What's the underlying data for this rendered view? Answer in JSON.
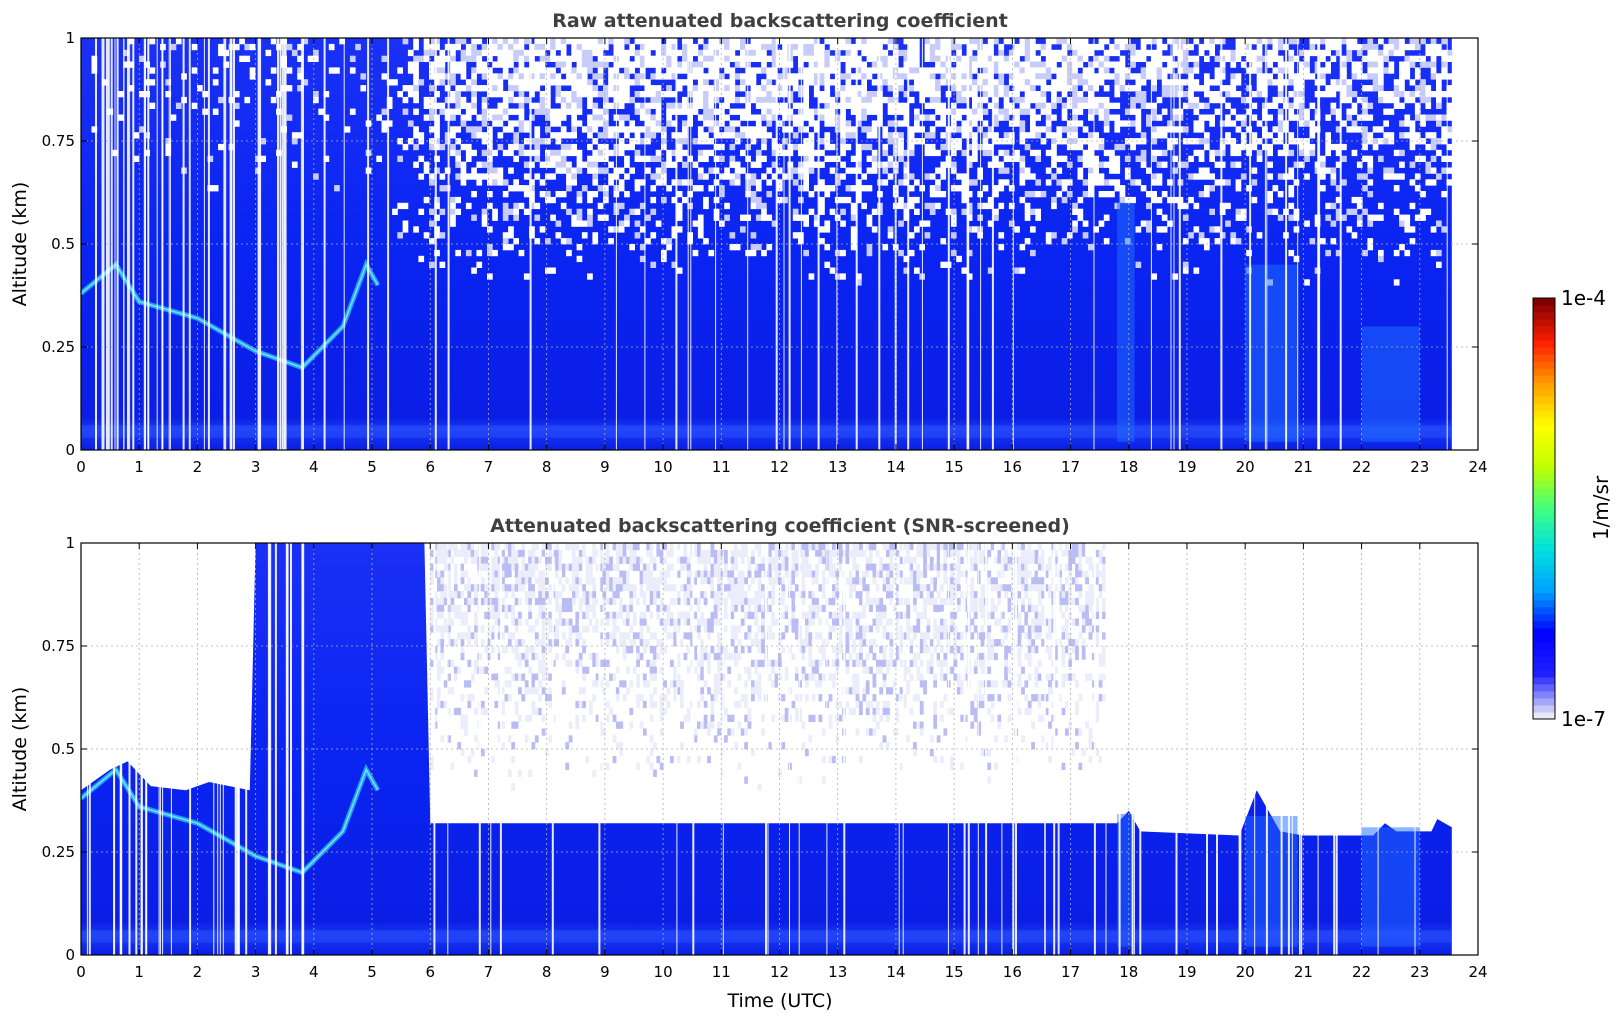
{
  "chart_data": [
    {
      "type": "heatmap",
      "title": "Raw attenuated backscattering coefficient",
      "xlabel": "",
      "ylabel": "Altitude (km)",
      "xlim": [
        0,
        24
      ],
      "ylim": [
        0,
        1
      ],
      "x_ticks": [
        "0",
        "1",
        "2",
        "3",
        "4",
        "5",
        "6",
        "7",
        "8",
        "9",
        "10",
        "11",
        "12",
        "13",
        "14",
        "15",
        "16",
        "17",
        "18",
        "19",
        "20",
        "21",
        "22",
        "23",
        "24"
      ],
      "y_ticks": [
        "0",
        "0.25",
        "0.5",
        "0.75",
        "1"
      ],
      "y_tick_values": [
        0,
        0.25,
        0.5,
        0.75,
        1
      ],
      "grid": true,
      "data_end_time": 23.55,
      "features": {
        "layer_top_km": [
          [
            0,
            0.38
          ],
          [
            0.6,
            0.45
          ],
          [
            1.0,
            0.36
          ],
          [
            2.0,
            0.32
          ],
          [
            3.0,
            0.24
          ],
          [
            3.8,
            0.2
          ],
          [
            4.5,
            0.3
          ],
          [
            4.9,
            0.45
          ],
          [
            5.1,
            0.4
          ]
        ],
        "dense_plumes": [
          {
            "time_start": 17.8,
            "time_end": 18.1,
            "alt_top_km": 0.6
          },
          {
            "time_start": 20.0,
            "time_end": 20.9,
            "alt_top_km": 0.45
          },
          {
            "time_start": 22.0,
            "time_end": 23.0,
            "alt_top_km": 0.3
          }
        ]
      }
    },
    {
      "type": "heatmap",
      "title": "Attenuated backscattering coefficient (SNR-screened)",
      "xlabel": "Time (UTC)",
      "ylabel": "Altitude (km)",
      "xlim": [
        0,
        24
      ],
      "ylim": [
        0,
        1
      ],
      "x_ticks": [
        "0",
        "1",
        "2",
        "3",
        "4",
        "5",
        "6",
        "7",
        "8",
        "9",
        "10",
        "11",
        "12",
        "13",
        "14",
        "15",
        "16",
        "17",
        "18",
        "19",
        "20",
        "21",
        "22",
        "23",
        "24"
      ],
      "y_ticks": [
        "0",
        "0.25",
        "0.5",
        "0.75",
        "1"
      ],
      "y_tick_values": [
        0,
        0.25,
        0.5,
        0.75,
        1
      ],
      "grid": true,
      "data_end_time": 23.55,
      "screened_top_km": [
        [
          0.0,
          0.4
        ],
        [
          0.5,
          0.45
        ],
        [
          0.8,
          0.47
        ],
        [
          1.2,
          0.41
        ],
        [
          1.8,
          0.4
        ],
        [
          2.2,
          0.42
        ],
        [
          2.9,
          0.4
        ],
        [
          3.0,
          1.0
        ],
        [
          5.9,
          1.0
        ],
        [
          6.0,
          0.32
        ],
        [
          17.8,
          0.32
        ],
        [
          18.0,
          0.35
        ],
        [
          18.2,
          0.3
        ],
        [
          19.9,
          0.29
        ],
        [
          20.2,
          0.4
        ],
        [
          20.6,
          0.3
        ],
        [
          21.0,
          0.29
        ],
        [
          22.2,
          0.29
        ],
        [
          22.4,
          0.32
        ],
        [
          22.6,
          0.3
        ],
        [
          23.2,
          0.3
        ],
        [
          23.3,
          0.33
        ],
        [
          23.55,
          0.31
        ]
      ]
    }
  ],
  "colorbar": {
    "label": "1/m/sr",
    "max_label": "1e-4",
    "min_label": "1e-7",
    "colors": [
      "#e8e8f8",
      "#2020ff",
      "#0000ff",
      "#00a0ff",
      "#00e0e0",
      "#40ff80",
      "#c0ff00",
      "#ffff00",
      "#ffa000",
      "#ff2000",
      "#800000"
    ]
  }
}
